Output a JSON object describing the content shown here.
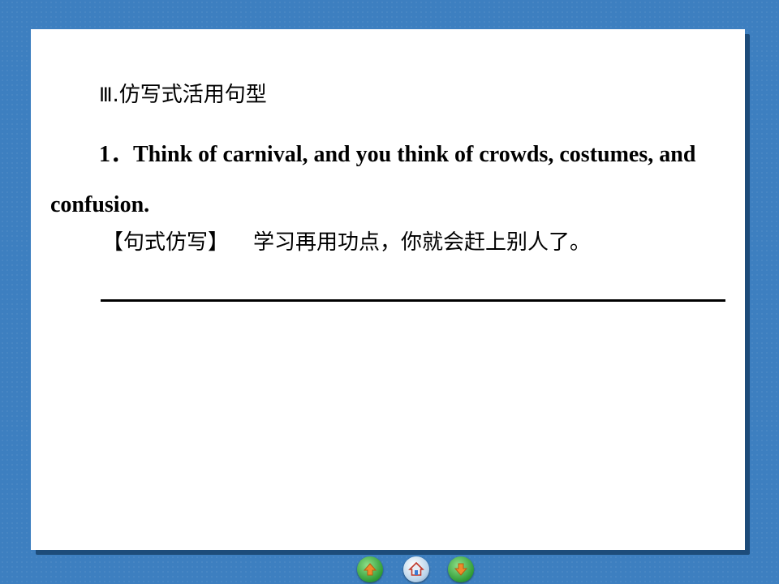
{
  "slide": {
    "heading_num": "Ⅲ",
    "heading_text": ".仿写式活用句型",
    "sentence": "1．Think of carnival, and you think of crowds, costumes, and confusion.",
    "imitate_label": "【句式仿写】",
    "imitate_task": "学习再用功点，你就会赶上别人了。"
  },
  "nav": {
    "prev_icon": "up-arrow-icon",
    "home_icon": "home-icon",
    "next_icon": "down-arrow-icon"
  },
  "colors": {
    "background": "#3d7fc0",
    "slide": "#ffffff",
    "nav_green": "#2f9a35",
    "nav_arrow": "#f08a2a"
  }
}
